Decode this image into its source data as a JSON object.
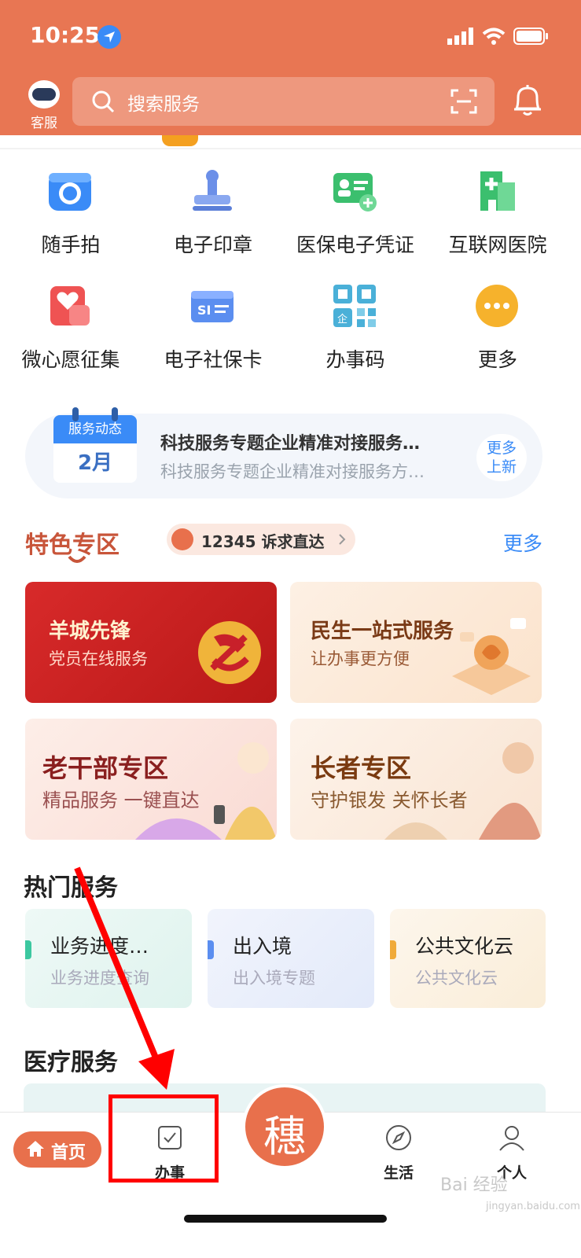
{
  "status": {
    "time": "10:25"
  },
  "header": {
    "bot_label": "客服",
    "search_placeholder": "搜索服务"
  },
  "grid": [
    {
      "label": "随手拍",
      "icon": "camera-icon"
    },
    {
      "label": "电子印章",
      "icon": "stamp-icon"
    },
    {
      "label": "医保电子凭证",
      "icon": "medical-card-icon"
    },
    {
      "label": "互联网医院",
      "icon": "hospital-icon"
    },
    {
      "label": "微心愿征集",
      "icon": "wish-icon"
    },
    {
      "label": "电子社保卡",
      "icon": "social-card-icon"
    },
    {
      "label": "办事码",
      "icon": "qr-code-icon"
    },
    {
      "label": "更多",
      "icon": "more-icon"
    }
  ],
  "news": {
    "cal_top": "服务动态",
    "cal_month": "2月",
    "line1": "科技服务专题企业精准对接服务…",
    "line2": "科技服务专题企业精准对接服务方…",
    "more_l1": "更多",
    "more_l2": "上新"
  },
  "featured": {
    "title": "特色专区",
    "hotline": "12345 诉求直达",
    "more": "更多",
    "cards": [
      {
        "title": "羊城先锋",
        "sub": "党员在线服务"
      },
      {
        "title": "民生一站式服务",
        "sub": "让办事更方便"
      },
      {
        "title": "老干部专区",
        "sub": "精品服务 一键直达"
      },
      {
        "title": "长者专区",
        "sub": "守护银发 关怀长者"
      }
    ]
  },
  "hot": {
    "title": "热门服务",
    "items": [
      {
        "title": "业务进度…",
        "sub": "业务进度查询"
      },
      {
        "title": "出入境",
        "sub": "出入境专题"
      },
      {
        "title": "公共文化云",
        "sub": "公共文化云"
      }
    ]
  },
  "medical": {
    "title": "医疗服务"
  },
  "tabbar": {
    "home": "首页",
    "work": "办事",
    "center_glyph": "穗",
    "life": "生活",
    "me": "个人"
  },
  "watermark": {
    "main": "Bai 经验",
    "sub": "jingyan.baidu.com"
  },
  "colors": {
    "header": "#e87653",
    "accent_blue": "#3a8bf7",
    "annotation": "#ff0000"
  }
}
